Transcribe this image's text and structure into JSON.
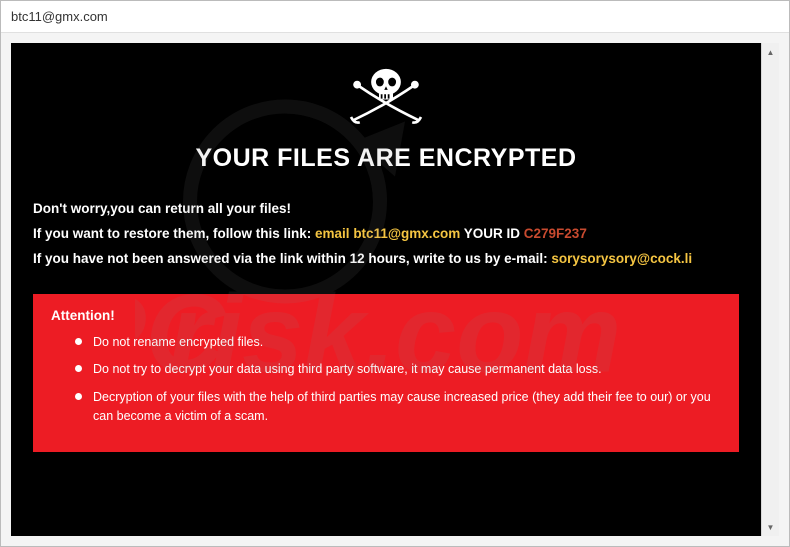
{
  "window": {
    "title": "btc11@gmx.com"
  },
  "ransom": {
    "heading": "YOUR FILES ARE ENCRYPTED",
    "line1": "Don't worry,you can return all your files!",
    "line2_prefix": "If you want to restore them, follow this link: ",
    "line2_email_label": "email ",
    "line2_email": "btc11@gmx.com",
    "line2_yourid_label": "  YOUR ID ",
    "line2_yourid": "C279F237",
    "line3_prefix": "If you have not been answered via the link within 12 hours, write to us by e-mail: ",
    "line3_email": "sorysorysory@cock.li",
    "attention_title": "Attention!",
    "bullets": [
      "Do not rename encrypted files.",
      "Do not try to decrypt your data using third party software, it may cause permanent data loss.",
      "Decryption of your files with the help of third parties may cause increased price (they add their fee to our) or you can become a victim of a scam."
    ]
  },
  "icons": {
    "skull": "skull-crossbones-icon",
    "scroll_up": "chevron-up-icon",
    "scroll_down": "chevron-down-icon"
  },
  "watermark": {
    "text": "pcrisk.com"
  },
  "colors": {
    "accent_yellow": "#f5c542",
    "accent_id": "#c84a2f",
    "attention_bg": "#ed1c24"
  }
}
